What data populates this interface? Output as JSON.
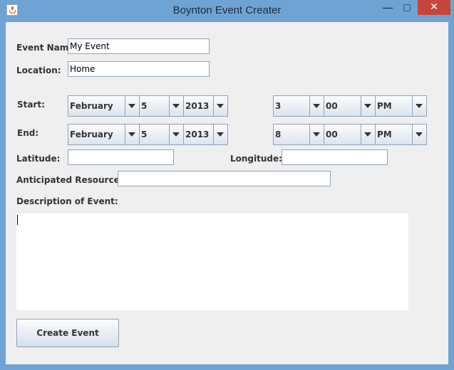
{
  "window": {
    "title": "Boynton Event Creater"
  },
  "labels": {
    "event_name": "Event Name:",
    "location": "Location:",
    "start": "Start:",
    "end": "End:",
    "latitude": "Latitude:",
    "longitude": "Longitude:",
    "resources": "Anticipated Resources:",
    "description": "Description of Event:"
  },
  "fields": {
    "event_name": "My Event",
    "location": "Home",
    "latitude": "",
    "longitude": "",
    "resources": "",
    "description": ""
  },
  "start": {
    "month": "February",
    "day": "5",
    "year": "2013",
    "hour": "3",
    "minute": "00",
    "ampm": "PM"
  },
  "end": {
    "month": "February",
    "day": "5",
    "year": "2013",
    "hour": "8",
    "minute": "00",
    "ampm": "PM"
  },
  "buttons": {
    "create": "Create Event"
  },
  "icons": {
    "app": "java-cup-icon",
    "minimize": "minimize-icon",
    "maximize": "maximize-icon",
    "close": "close-icon"
  },
  "colors": {
    "titlebar": "#6fa3d3",
    "close": "#c7463a",
    "panel": "#efefef"
  }
}
